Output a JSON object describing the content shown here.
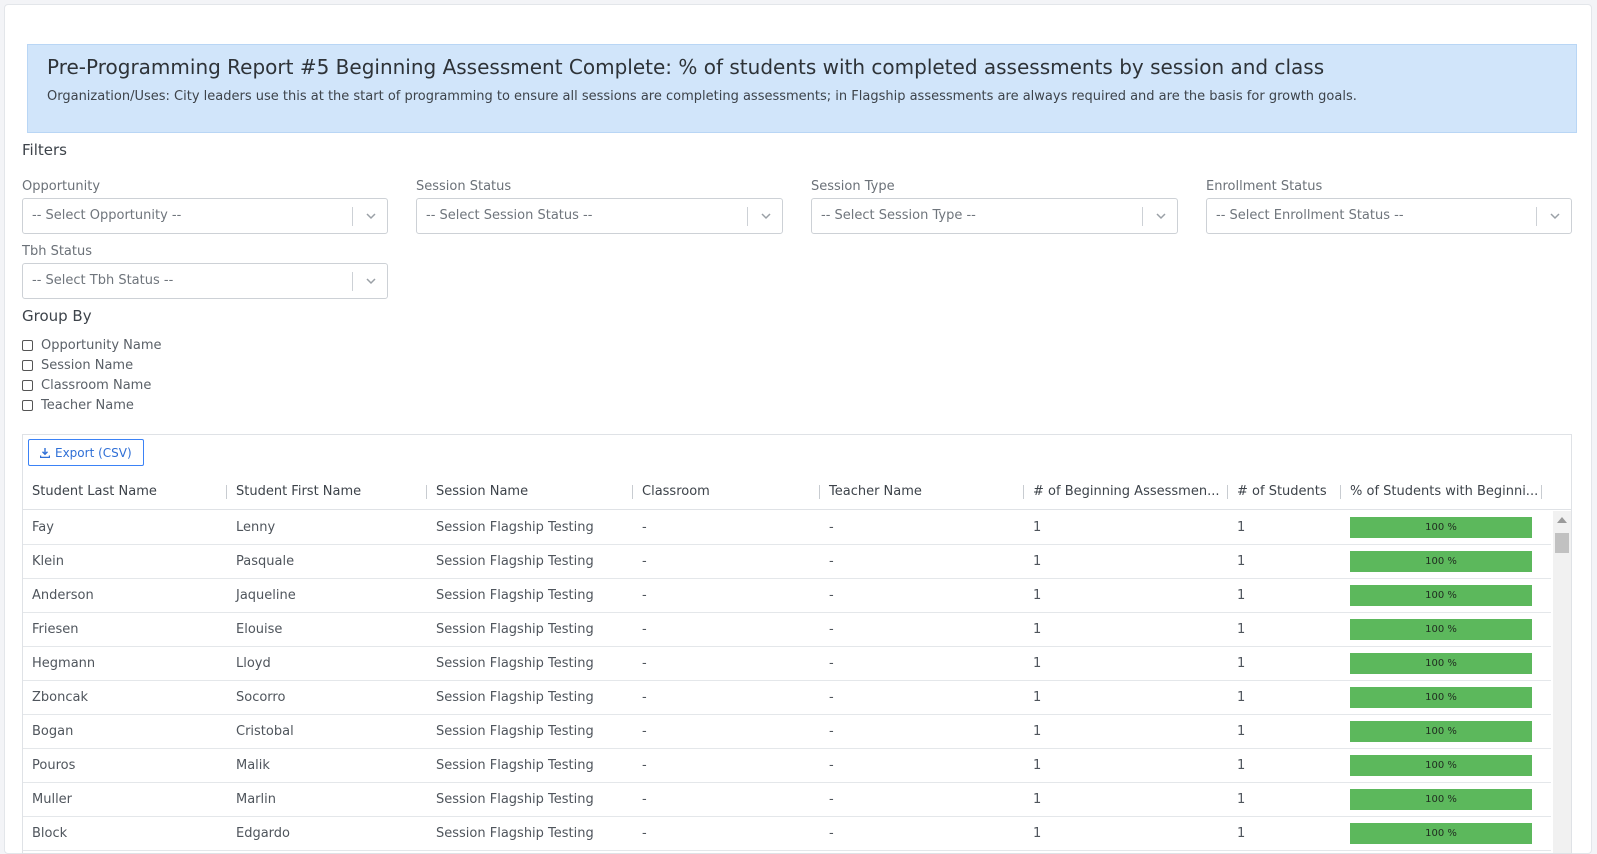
{
  "banner": {
    "title": "Pre-Programming Report #5 Beginning Assessment Complete: % of students with completed assessments by session and class",
    "description": "Organization/Uses: City leaders use this at the start of programming to ensure all sessions are completing assessments; in Flagship assessments are always required and are the basis for growth goals."
  },
  "filters": {
    "title": "Filters",
    "opportunity": {
      "label": "Opportunity",
      "placeholder": "-- Select Opportunity --"
    },
    "session_status": {
      "label": "Session Status",
      "placeholder": "-- Select Session Status --"
    },
    "session_type": {
      "label": "Session Type",
      "placeholder": "-- Select Session Type --"
    },
    "enrollment_status": {
      "label": "Enrollment Status",
      "placeholder": "-- Select Enrollment Status --"
    },
    "tbh_status": {
      "label": "Tbh Status",
      "placeholder": "-- Select Tbh Status --"
    }
  },
  "group_by": {
    "title": "Group By",
    "options": [
      "Opportunity Name",
      "Session Name",
      "Classroom Name",
      "Teacher Name"
    ]
  },
  "grid": {
    "export_label": "Export (CSV)",
    "columns": [
      "Student Last Name",
      "Student First Name",
      "Session Name",
      "Classroom",
      "Teacher Name",
      "# of Beginning Assessmen...",
      "# of Students",
      "% of Students with Beginni..."
    ],
    "rows": [
      [
        "Fay",
        "Lenny",
        "Session Flagship Testing",
        "-",
        "-",
        "1",
        "1",
        "100 %"
      ],
      [
        "Klein",
        "Pasquale",
        "Session Flagship Testing",
        "-",
        "-",
        "1",
        "1",
        "100 %"
      ],
      [
        "Anderson",
        "Jaqueline",
        "Session Flagship Testing",
        "-",
        "-",
        "1",
        "1",
        "100 %"
      ],
      [
        "Friesen",
        "Elouise",
        "Session Flagship Testing",
        "-",
        "-",
        "1",
        "1",
        "100 %"
      ],
      [
        "Hegmann",
        "Lloyd",
        "Session Flagship Testing",
        "-",
        "-",
        "1",
        "1",
        "100 %"
      ],
      [
        "Zboncak",
        "Socorro",
        "Session Flagship Testing",
        "-",
        "-",
        "1",
        "1",
        "100 %"
      ],
      [
        "Bogan",
        "Cristobal",
        "Session Flagship Testing",
        "-",
        "-",
        "1",
        "1",
        "100 %"
      ],
      [
        "Pouros",
        "Malik",
        "Session Flagship Testing",
        "-",
        "-",
        "1",
        "1",
        "100 %"
      ],
      [
        "Muller",
        "Marlin",
        "Session Flagship Testing",
        "-",
        "-",
        "1",
        "1",
        "100 %"
      ],
      [
        "Block",
        "Edgardo",
        "Session Flagship Testing",
        "-",
        "-",
        "1",
        "1",
        "100 %"
      ]
    ]
  },
  "colors": {
    "banner_bg": "#d1e5fa",
    "bar_fill": "#5cb85c",
    "export_accent": "#2f6fd6"
  }
}
